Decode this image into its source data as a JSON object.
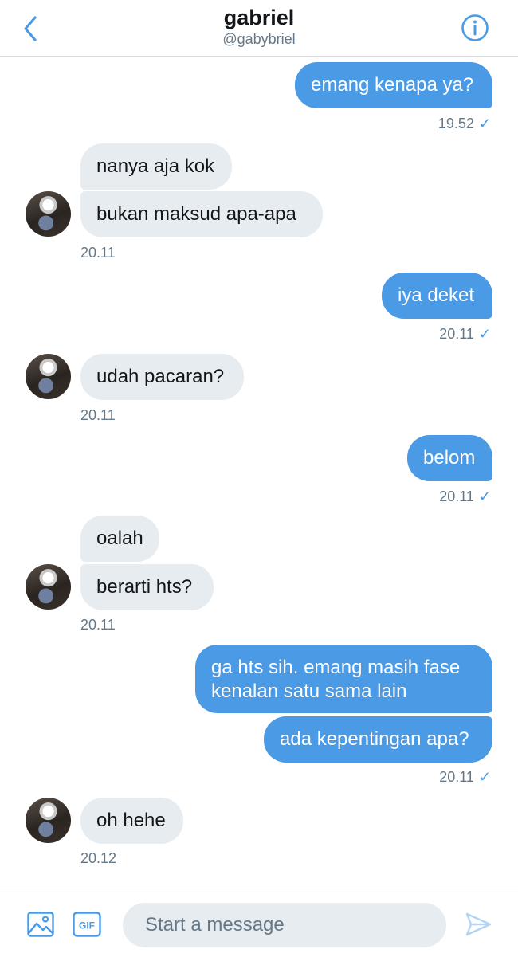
{
  "header": {
    "title": "gabriel",
    "handle": "@gabybriel",
    "back_icon": "chevron-left-icon",
    "info_icon": "info-icon"
  },
  "messages": [
    {
      "id": "m1",
      "direction": "sent",
      "text": "emang kenapa ya?"
    },
    {
      "id": "t1",
      "time": "19.52",
      "read": "✓"
    },
    {
      "id": "m2",
      "direction": "received",
      "text": "nanya aja kok"
    },
    {
      "id": "m3",
      "direction": "received",
      "text": "bukan maksud apa-apa"
    },
    {
      "id": "t2",
      "time": "20.11"
    },
    {
      "id": "m4",
      "direction": "sent",
      "text": "iya deket"
    },
    {
      "id": "t3",
      "time": "20.11",
      "read": "✓"
    },
    {
      "id": "m5",
      "direction": "received",
      "text": "udah pacaran?"
    },
    {
      "id": "t4",
      "time": "20.11"
    },
    {
      "id": "m6",
      "direction": "sent",
      "text": "belom"
    },
    {
      "id": "t5",
      "time": "20.11",
      "read": "✓"
    },
    {
      "id": "m7",
      "direction": "received",
      "text": "oalah"
    },
    {
      "id": "m8",
      "direction": "received",
      "text": "berarti hts?"
    },
    {
      "id": "t6",
      "time": "20.11"
    },
    {
      "id": "m9",
      "direction": "sent",
      "lines": [
        "ga hts sih. emang masih fase",
        "kenalan satu sama lain"
      ]
    },
    {
      "id": "m10",
      "direction": "sent",
      "text": "ada kepentingan apa?"
    },
    {
      "id": "t7",
      "time": "20.11",
      "read": "✓"
    },
    {
      "id": "m11",
      "direction": "received",
      "text": "oh hehe"
    },
    {
      "id": "t8",
      "time": "20.12"
    }
  ],
  "composer": {
    "placeholder": "Start a message",
    "media_icon": "image-icon",
    "gif_label": "GIF",
    "send_icon": "send-icon"
  },
  "colors": {
    "accent": "#4a9ae6",
    "received_bubble": "#e6ecf0",
    "secondary_text": "#657786"
  }
}
